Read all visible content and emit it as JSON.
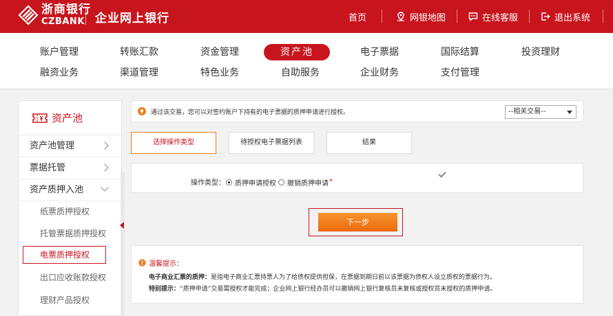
{
  "header": {
    "logo_cn": "浙商银行",
    "logo_en": "CZBANK",
    "site_title": "企业网上银行",
    "links": [
      {
        "label": "首页",
        "icon": "none"
      },
      {
        "label": "网银地图",
        "icon": "map-pin-icon"
      },
      {
        "label": "在线客服",
        "icon": "chat-icon"
      },
      {
        "label": "退出系统",
        "icon": "logout-icon"
      }
    ]
  },
  "mainnav": {
    "row1": [
      "账户管理",
      "转账汇款",
      "资金管理",
      "资产池",
      "电子票据",
      "国际结算",
      "投资理财"
    ],
    "row2": [
      "融资业务",
      "渠道管理",
      "特色业务",
      "自助服务",
      "企业财务",
      "支付管理"
    ],
    "active": "资产池"
  },
  "sidebar": {
    "title": "资产池",
    "items": [
      {
        "label": "资产池管理",
        "chevron": "right"
      },
      {
        "label": "票据托管",
        "chevron": "right"
      },
      {
        "label": "资产质押入池",
        "chevron": "down"
      }
    ],
    "subitems": [
      "纸票质押授权",
      "托管票据质押授权",
      "电票质押授权",
      "出口应收账款授权",
      "理财产品授权"
    ],
    "active_subitem": "电票质押授权"
  },
  "notice": {
    "text": "通过该交易，您可以对签约账户下持有的电子票据的质押申请进行授权。",
    "related_select": "--相关交易--"
  },
  "steps": [
    "选择操作类型",
    "待授权电子票据列表",
    "结果"
  ],
  "operation": {
    "label": "操作类型：",
    "options": [
      "质押申请授权",
      "撤销质押申请"
    ],
    "selected": "质押申请授权",
    "required_mark": "*"
  },
  "next_button": "下一步",
  "tips": {
    "title": "温馨提示：",
    "line1_bold": "电子商业汇票的质押：",
    "line1_text": "是指电子商业汇票持票人为了给债权提供担保，在票据到期日前以该票据为债权人设立质权的票据行为。",
    "line2_bold": "特别提示：",
    "line2_text": "“质押申请”交易需授权才能完成；企业网上银行经办员可以撤销网上银行复核员未复核或授权员未授权的质押申请。"
  },
  "colors": {
    "brand_red": "#c8151d",
    "button_orange": "#f07d1a"
  }
}
